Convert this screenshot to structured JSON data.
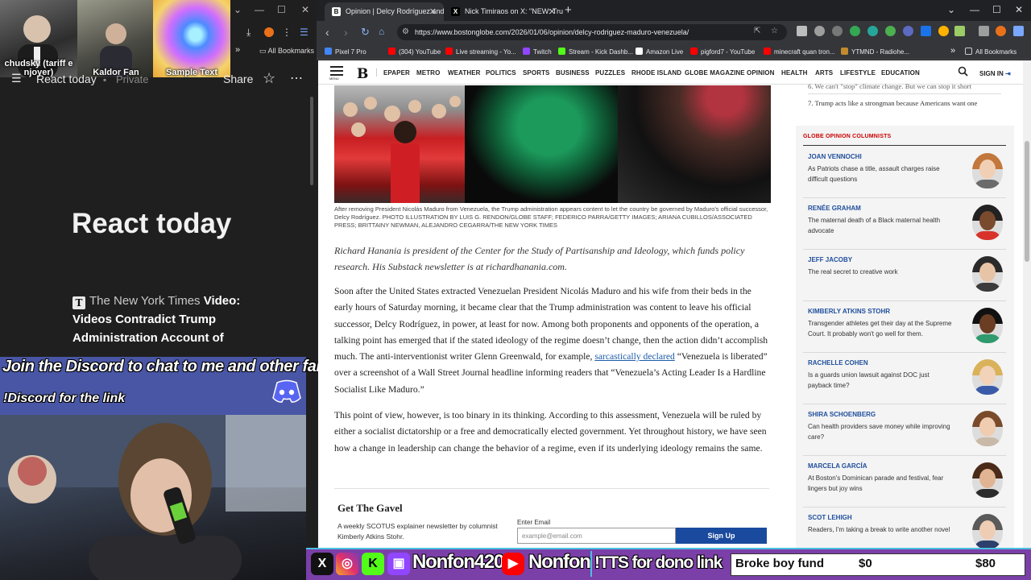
{
  "left_window": {
    "thumbnails": [
      {
        "caption": "chudsky (tariff e njoyer)"
      },
      {
        "caption": "Kaldor Fan"
      },
      {
        "caption": "Sample Text"
      }
    ],
    "page_bar": {
      "title": "React today",
      "privacy": "Private",
      "share": "Share"
    },
    "video_title": "React today",
    "source": {
      "publisher": "The New York Times",
      "headline": "Video: Videos Contradict Trump Administration Account of"
    }
  },
  "overlay": {
    "discord_line1": "Join the Discord to chat to me and other fans!",
    "discord_line2": "!Discord for the link"
  },
  "browser": {
    "tabs": [
      {
        "title": "Opinion | Delcy Rodríguez and",
        "active": true
      },
      {
        "title": "Nick Timiraos on X: \"NEW: Trum",
        "active": false
      }
    ],
    "new_tab": "+",
    "url": "https://www.bostonglobe.com/2026/01/06/opinion/delcy-rodriguez-maduro-venezuela/",
    "bookmarks": [
      {
        "label": "Pixel 7 Pro",
        "color": "#4285f4"
      },
      {
        "label": "(304) YouTube",
        "color": "#ff0000"
      },
      {
        "label": "Live streaming - Yo...",
        "color": "#ff0000"
      },
      {
        "label": "Twitch",
        "color": "#9146ff"
      },
      {
        "label": "Stream - Kick Dashb...",
        "color": "#53fc18"
      },
      {
        "label": "Amazon Live",
        "color": "#ffffff"
      },
      {
        "label": "pigford7 - YouTube",
        "color": "#ff0000"
      },
      {
        "label": "minecraft quan tron...",
        "color": "#ff0000"
      },
      {
        "label": "YTMND - Radiohe...",
        "color": "#c28a2e"
      }
    ],
    "all_bookmarks": "All Bookmarks"
  },
  "globe": {
    "menu_label": "MENU",
    "logo": "B",
    "nav": [
      "EPAPER",
      "METRO",
      "WEATHER",
      "POLITICS",
      "SPORTS",
      "BUSINESS",
      "PUZZLES",
      "RHODE ISLAND",
      "GLOBE MAGAZINE",
      "OPINION",
      "HEALTH",
      "ARTS",
      "LIFESTYLE",
      "EDUCATION"
    ],
    "sign_in": "SIGN IN",
    "caption": "After removing President Nicolás Maduro from Venezuela, the Trump administration appears content to let the country be governed by Maduro's official successor, Delcy Rodríguez. PHOTO ILLUSTRATION BY LUIS G. RENDON/GLOBE STAFF; FEDERICO PARRA/GETTY IMAGES; ARIANA CUBILLOS/ASSOCIATED PRESS; BRITTAINY NEWMAN, ALEJANDRO CEGARRA/THE NEW YORK TIMES",
    "byline": "Richard Hanania is president of the Center for the Study of Partisanship and Ideology, which funds policy research. His Substack newsletter is at richardhanania.com.",
    "para1_a": "Soon after the United States extracted Venezuelan President Nicolás Maduro and his wife from their beds in the early hours of Saturday morning, it became clear that the Trump administration was content to leave his official successor, Delcy Rodríguez, in power, at least for now. Among both proponents and opponents of the operation, a talking point has emerged that if the stated ideology of the regime doesn’t change, then the action didn’t accomplish much. The anti-interventionist writer Glenn Greenwald, for example, ",
    "para1_link": "sarcastically declared",
    "para1_b": " “Venezuela is liberated” over a screenshot of a Wall Street Journal headline informing readers that “Venezuela’s Acting Leader Is a Hardline Socialist Like Maduro.”",
    "para2": "This point of view, however, is too binary in its thinking. According to this assessment, Venezuela will be ruled by either a socialist dictatorship or a free and democratically elected government. Yet throughout history, we have seen how a change in leadership can change the behavior of a regime, even if its underlying ideology remains the same.",
    "newsletter": {
      "title": "Get The Gavel",
      "desc": "A weekly SCOTUS explainer newsletter by columnist Kimberly Atkins Stohr.",
      "email_label": "Enter Email",
      "email_placeholder": "example@email.com",
      "signup": "Sign Up"
    },
    "sidebar_top": [
      {
        "num": "6.",
        "text": "We can't \"stop\" climate change. But we can stop it short"
      },
      {
        "num": "7.",
        "text": "Trump acts like a strongman because Americans want one"
      }
    ],
    "columnists_header": "GLOBE OPINION COLUMNISTS",
    "columnists": [
      {
        "name": "JOAN VENNOCHI",
        "headline": "As Patriots chase a title, assault charges raise difficult questions"
      },
      {
        "name": "RENÉE GRAHAM",
        "headline": "The maternal death of a Black maternal health advocate"
      },
      {
        "name": "JEFF JACOBY",
        "headline": "The real secret to creative work"
      },
      {
        "name": "KIMBERLY ATKINS STOHR",
        "headline": "Transgender athletes get their day at the Supreme Court. It probably won't go well for them."
      },
      {
        "name": "RACHELLE COHEN",
        "headline": "Is a guards union lawsuit against DOC just payback time?"
      },
      {
        "name": "SHIRA SCHOENBERG",
        "headline": "Can health providers save money while improving care?"
      },
      {
        "name": "MARCELA GARCÍA",
        "headline": "At Boston's Dominican parade and festival, fear lingers but joy wins"
      },
      {
        "name": "SCOT LEHIGH",
        "headline": "Readers, I'm taking a break to write another novel"
      }
    ]
  },
  "stream_bar": {
    "handle1": "Nonfon420",
    "handle2": "Nonfon",
    "tts": "!TTS for dono link",
    "fund_label": "Broke boy fund",
    "fund_current": "$0",
    "fund_goal": "$80"
  }
}
